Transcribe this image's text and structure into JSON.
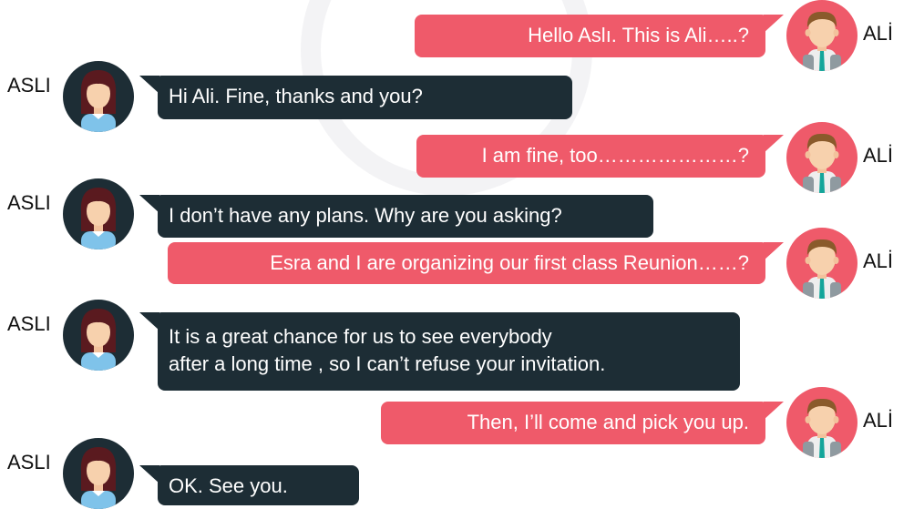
{
  "speakers": {
    "ali": {
      "name": "ALİ",
      "avatar_icon": "male-avatar-icon",
      "color": "#ef5a6a"
    },
    "asli": {
      "name": "ASLI",
      "avatar_icon": "female-avatar-icon",
      "color": "#1d2d35"
    }
  },
  "messages": [
    {
      "speaker": "ALİ",
      "text": "Hello Aslı. This is Ali…..?"
    },
    {
      "speaker": "ASLI",
      "text": "Hi Ali. Fine, thanks and you?"
    },
    {
      "speaker": "ALİ",
      "text": "I am fine, too…………………?"
    },
    {
      "speaker": "ASLI",
      "text": "I don’t have any plans. Why are you asking?"
    },
    {
      "speaker": "ALİ",
      "text": "Esra and I are organizing our first class Reunion……?"
    },
    {
      "speaker": "ASLI",
      "lines": [
        "It is a great chance for us to see everybody",
        "after a long time , so I can’t refuse your invitation."
      ]
    },
    {
      "speaker": "ALİ",
      "text": "Then, I’ll come and pick you up."
    },
    {
      "speaker": "ASLI",
      "text": "OK. See you."
    }
  ]
}
